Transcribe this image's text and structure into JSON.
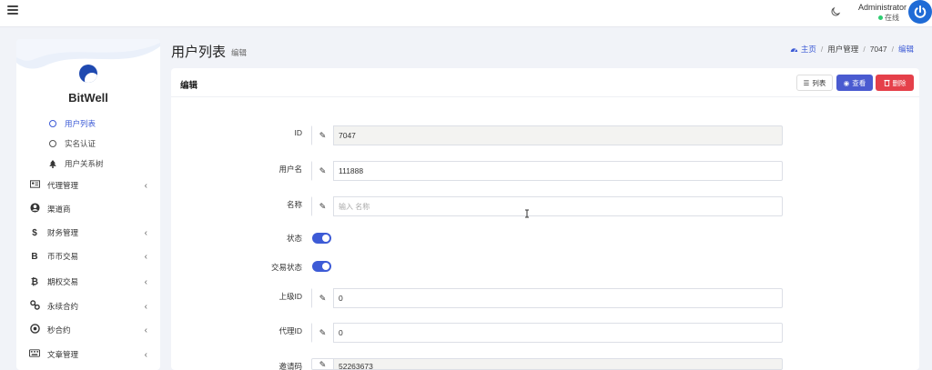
{
  "topbar": {
    "admin_name": "Administrator",
    "admin_status": "在线",
    "status_color": "#2ecc71",
    "icons": [
      "menu-icon",
      "moon-icon",
      "power-icon"
    ]
  },
  "sidebar": {
    "brand": "BitWell",
    "sub_items": [
      {
        "label": "用户列表",
        "active": true
      },
      {
        "label": "实名认证",
        "active": false
      },
      {
        "label": "用户关系树",
        "active": false
      }
    ],
    "menu_items": [
      {
        "label": "代理管理",
        "icon": "id-card-icon"
      },
      {
        "label": "渠道商",
        "icon": "user-circle-icon"
      },
      {
        "label": "财务管理",
        "icon": "dollar-icon"
      },
      {
        "label": "币币交易",
        "icon": "bitcoin-icon"
      },
      {
        "label": "期权交易",
        "icon": "bitcoin-icon"
      },
      {
        "label": "永续合约",
        "icon": "link-icon"
      },
      {
        "label": "秒合约",
        "icon": "target-icon"
      },
      {
        "label": "文章管理",
        "icon": "keyboard-icon"
      }
    ]
  },
  "header": {
    "title": "用户列表",
    "subtitle": "编辑",
    "breadcrumb": [
      "主页",
      "用户管理",
      "7047",
      "编辑"
    ]
  },
  "card": {
    "title": "编辑",
    "buttons": {
      "list": "列表",
      "view": "查看",
      "delete": "删除"
    },
    "accent": "#4a5bd0",
    "danger": "#e5404a"
  },
  "form": {
    "id_label": "ID",
    "id_value": "7047",
    "username_label": "用户名",
    "username_value": "111888",
    "name_label": "名称",
    "name_placeholder": "输入 名称",
    "status_label": "状态",
    "status_on": true,
    "trade_status_label": "交易状态",
    "trade_status_on": true,
    "parent_id_label": "上级ID",
    "parent_id_value": "0",
    "agent_id_label": "代理ID",
    "agent_id_value": "0",
    "invite_label": "邀请码",
    "invite_value": "52263673"
  }
}
